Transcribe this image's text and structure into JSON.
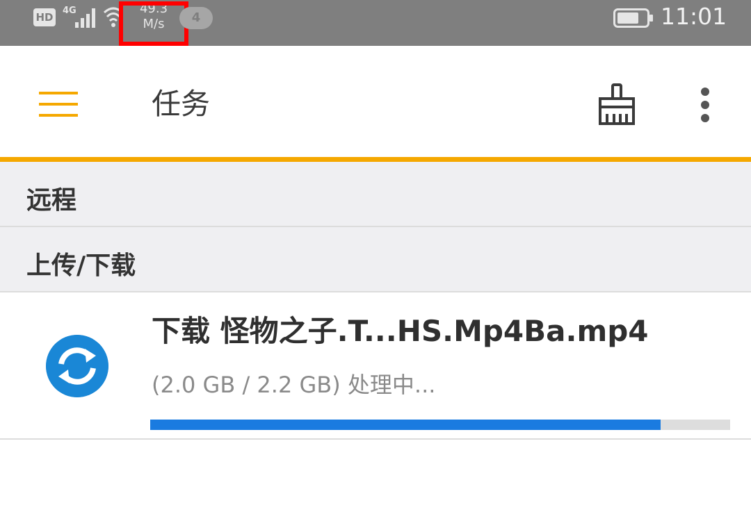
{
  "status_bar": {
    "hd_label": "HD",
    "network_type": "4G",
    "speed_value": "49.3",
    "speed_unit": "M/s",
    "notification_count": "4",
    "time": "11:01",
    "icons": [
      "signal-icon",
      "wifi-icon",
      "battery-icon"
    ]
  },
  "app_bar": {
    "title": "任务",
    "icons": [
      "menu-icon",
      "clean-brush-icon",
      "more-vert-icon"
    ],
    "accent_color": "#f5a800"
  },
  "sections": [
    {
      "label": "远程"
    },
    {
      "label": "上传/下载"
    }
  ],
  "tasks": [
    {
      "title": "下载 怪物之子.T...HS.Mp4Ba.mp4",
      "status": "(2.0 GB / 2.2 GB) 处理中...",
      "progress_fraction": 0.88,
      "icon": "sync-icon",
      "progress_color": "#1a7be0"
    }
  ]
}
